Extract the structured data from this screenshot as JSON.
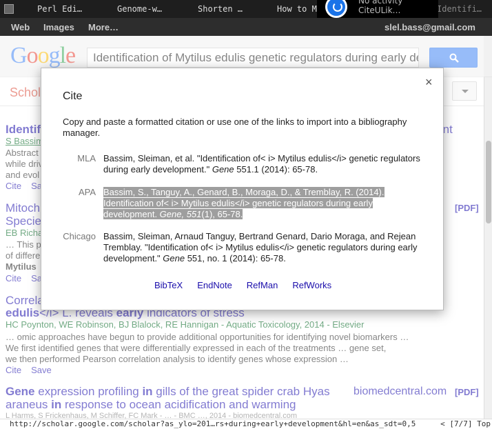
{
  "tabs": [
    {
      "title": "Perl Edi…"
    },
    {
      "title": "Genome-w…"
    },
    {
      "title": "Shorten …"
    },
    {
      "title": "How to M…"
    },
    {
      "title": "Identifi…"
    }
  ],
  "notification": {
    "line1": "No activity",
    "line2": "CiteULik…"
  },
  "gbar": {
    "web": "Web",
    "images": "Images",
    "more": "More…",
    "account": "slel.bass@gmail.com"
  },
  "search": {
    "logo": "Google",
    "query": "Identification of Mytilus edulis genetic regulators during early development"
  },
  "scholar": {
    "label": "Scholar"
  },
  "results": [
    {
      "title": "Identification",
      "title_tail": "ment",
      "authors": "S Bassim",
      "snippet1": "Abstract",
      "snippet2": "while driv",
      "snippet3": "and evol",
      "cite": "Cite",
      "save": "Save"
    },
    {
      "title": "Mitoch",
      "title2": "Specie",
      "authors": "EB Richa",
      "snippet1": "… This p",
      "snippet2": "of differe",
      "snippet3": "Mytilus",
      "pdf": "[PDF]",
      "cite": "Cite",
      "save": "Save"
    },
    {
      "title": "Correla",
      "title2_a": "edulis",
      "title2_b": "</i> L. reveals ",
      "title2_c": "early",
      "title2_d": " indicators of stress",
      "authors": "HC Poynton, WE Robinson, BJ Blalock, RE Hannigan - Aquatic Toxicology, 2014 - Elsevier",
      "snippet1": "… omic approaches have begun to provide additional opportunities for identifying novel biomarkers …",
      "snippet2": "We first identified genes that were differentially expressed in each of the treatments … gene set,",
      "snippet3": "we then performed Pearson correlation analysis to identify genes whose expression …",
      "cite": "Cite",
      "save": "Save"
    },
    {
      "title_a": "Gene",
      "title_b": " expression profiling ",
      "title_c": "in",
      "title_d": " gills of the great spider crab Hyas",
      "title2_a": "araneus ",
      "title2_b": "in",
      "title2_c": " response to ocean acidification and warming",
      "source": "biomedcentral.com",
      "pdf": "[PDF]",
      "authors": "L Harms, S Frickenhaus, M Schiffer, FC Mark - … - BMC …, 2014 - biomedcentral.com"
    }
  ],
  "cite_dialog": {
    "title": "Cite",
    "close": "×",
    "intro": "Copy and paste a formatted citation or use one of the links to import into a bibliography manager.",
    "mla_label": "MLA",
    "mla_a": "Bassim, Sleiman, et al. \"Identification of< i> Mytilus edulis</i> genetic regulators during early development.\" ",
    "mla_journal": "Gene",
    "mla_b": " 551.1 (2014): 65-78.",
    "apa_label": "APA",
    "apa_a": "Bassim, S., Tanguy, A., Genard, B., Moraga, D., & Tremblay, R. (2014). Identification of< i> Mytilus edulis</i> genetic regulators during early development. ",
    "apa_journal": "Gene, 551",
    "apa_b": "(1), 65-78.",
    "chicago_label": "Chicago",
    "chicago_a": "Bassim, Sleiman, Arnaud Tanguy, Bertrand Genard, Dario Moraga, and Rejean Tremblay. \"Identification of< i> Mytilus edulis</i> genetic regulators during early development.\" ",
    "chicago_journal": "Gene",
    "chicago_b": " 551, no. 1 (2014): 65-78.",
    "links": [
      "BibTeX",
      "EndNote",
      "RefMan",
      "RefWorks"
    ]
  },
  "status": {
    "url": "http://scholar.google.com/scholar?as_ylo=201…rs+during+early+development&hl=en&as_sdt=0,5",
    "position": "< [7/7] Top"
  },
  "colors": {
    "scholar_red": "#dd4b39",
    "link_blue": "#1a0dab",
    "author_green": "#006621",
    "search_blue": "#4285f4"
  }
}
